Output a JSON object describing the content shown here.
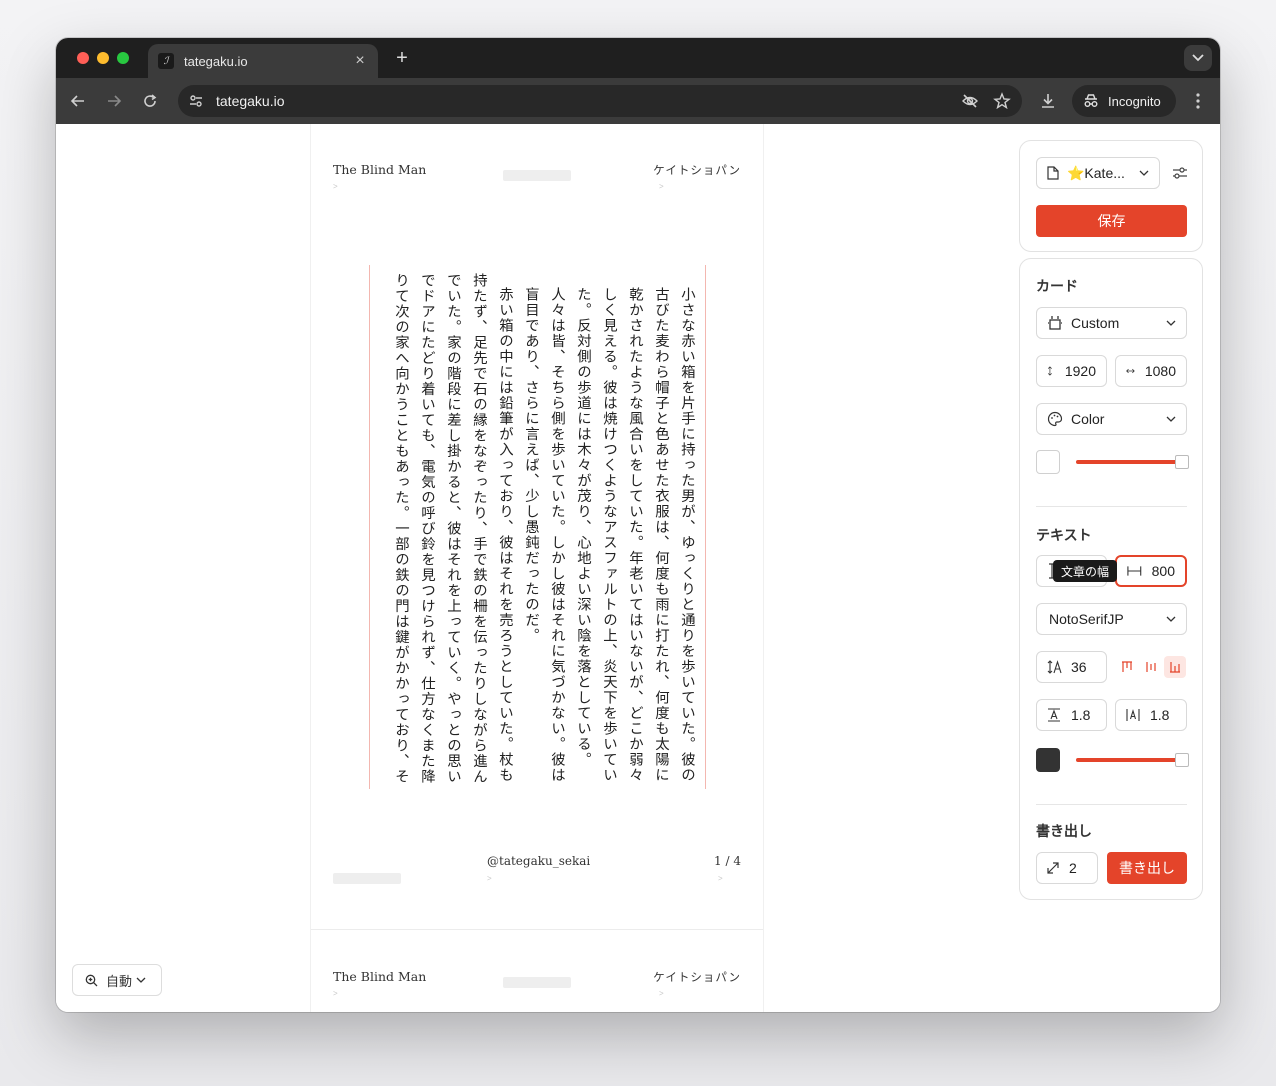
{
  "browser": {
    "tab_title": "tategaku.io",
    "url": "tategaku.io",
    "incognito_label": "Incognito",
    "favicon_glyph": "ℐ"
  },
  "card": {
    "header_left": "The Blind Man",
    "header_right": "ケイトショパン",
    "body_paragraphs": [
      "小さな赤い箱を片手に持った男が、ゆっくりと通りを歩いていた。彼の古びた麦わら帽子と色あせた衣服は、何度も雨に打たれ、何度も太陽に乾かされたような風合いをしていた。年老いてはいないが、どこか弱々しく見える。彼は焼けつくようなアスファルトの上、炎天下を歩いていた。反対側の歩道には木々が茂り、心地よい深い陰を落としている。人々は皆、そちら側を歩いていた。しかし彼はそれに気づかない。彼は盲目であり、さらに言えば、少し愚鈍だったのだ。",
      "赤い箱の中には鉛筆が入っており、彼はそれを売ろうとしていた。杖も持たず、足先で石の縁をなぞったり、手で鉄の柵を伝ったりしながら進んでいた。家の階段に差し掛かると、彼はそれを上っていく。やっとの思いでドアにたどり着いても、電気の呼び鈴を見つけられず、仕方なくまた降りて次の家へ向かうこともあった。一部の鉄の門は鍵がかかっており、そ"
    ],
    "footer_handle": "@tategaku_sekai",
    "footer_page": "1 / 4"
  },
  "zoom": {
    "label": "自動"
  },
  "panel": {
    "template_label": "⭐️Kate...",
    "save_label": "保存",
    "card_section_title": "カード",
    "size_preset": "Custom",
    "height": "1920",
    "width": "1080",
    "background_mode": "Color",
    "background_swatch": "#ffffff",
    "text_section_title": "テキスト",
    "text_width_tooltip": "文章の幅",
    "text_width_value": "800",
    "font_family": "NotoSerifJP",
    "font_size": "36",
    "line_height": "1.8",
    "letter_spacing": "1.8",
    "text_swatch": "#333333",
    "export_section_title": "書き出し",
    "export_scale": "2",
    "export_label": "書き出し",
    "accent_color": "#e4442a"
  }
}
